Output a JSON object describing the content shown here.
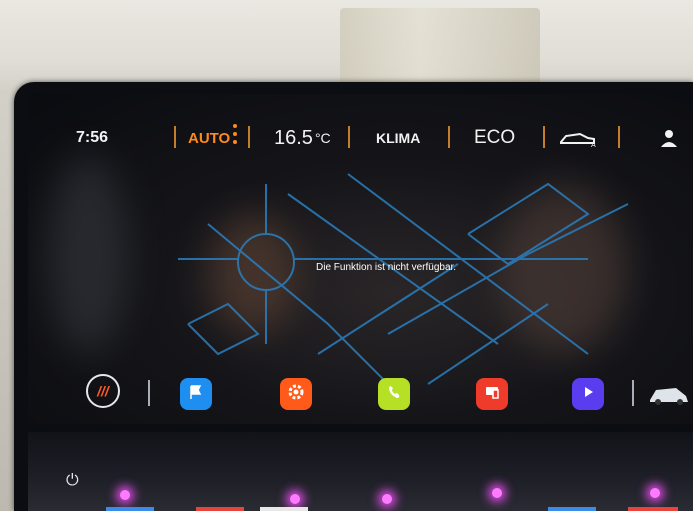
{
  "status_bar": {
    "time": "7:56",
    "mode": "AUTO",
    "temperature": "16.5",
    "temperature_unit": "°C",
    "climate": "KLIMA",
    "eco": "ECO"
  },
  "message": "Die Funktion ist nicht verfügbar.",
  "dock": {
    "climate_button_label": "///",
    "apps": [
      {
        "name": "navigation",
        "color": "#1e8ff0",
        "icon": "flag-icon"
      },
      {
        "name": "settings",
        "color": "#ff5a1a",
        "icon": "gear-icon"
      },
      {
        "name": "phone",
        "color": "#b6e025",
        "icon": "phone-icon"
      },
      {
        "name": "media-connect",
        "color": "#ef3b2a",
        "icon": "device-icon"
      },
      {
        "name": "media-player",
        "color": "#5b3df0",
        "icon": "play-icon"
      }
    ]
  },
  "colors": {
    "accent": "#ff8a1c",
    "map_lines": "#2a7fc0"
  }
}
